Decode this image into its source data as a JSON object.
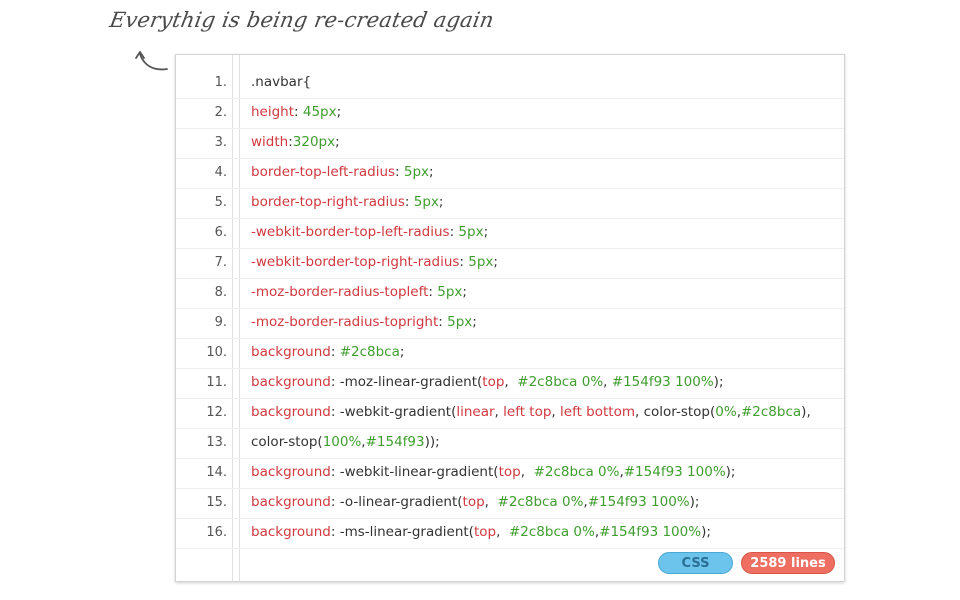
{
  "header": {
    "note": "Everythig is being re-created again"
  },
  "editor": {
    "lines": [
      {
        "number": "1.",
        "tokens": [
          {
            "text": ".navbar{",
            "type": "plain"
          }
        ]
      },
      {
        "number": "2.",
        "tokens": [
          {
            "text": "height",
            "type": "prop"
          },
          {
            "text": ": ",
            "type": "plain"
          },
          {
            "text": "45px",
            "type": "val"
          },
          {
            "text": ";",
            "type": "plain"
          }
        ]
      },
      {
        "number": "3.",
        "tokens": [
          {
            "text": "width",
            "type": "prop"
          },
          {
            "text": ":",
            "type": "plain"
          },
          {
            "text": "320px",
            "type": "val"
          },
          {
            "text": ";",
            "type": "plain"
          }
        ]
      },
      {
        "number": "4.",
        "tokens": [
          {
            "text": "border-top-left-radius",
            "type": "prop"
          },
          {
            "text": ": ",
            "type": "plain"
          },
          {
            "text": "5px",
            "type": "val"
          },
          {
            "text": ";",
            "type": "plain"
          }
        ]
      },
      {
        "number": "5.",
        "tokens": [
          {
            "text": "border-top-right-radius",
            "type": "prop"
          },
          {
            "text": ": ",
            "type": "plain"
          },
          {
            "text": "5px",
            "type": "val"
          },
          {
            "text": ";",
            "type": "plain"
          }
        ]
      },
      {
        "number": "6.",
        "tokens": [
          {
            "text": "-webkit-border-top-left-radius",
            "type": "prop"
          },
          {
            "text": ": ",
            "type": "plain"
          },
          {
            "text": "5px",
            "type": "val"
          },
          {
            "text": ";",
            "type": "plain"
          }
        ]
      },
      {
        "number": "7.",
        "tokens": [
          {
            "text": "-webkit-border-top-right-radius",
            "type": "prop"
          },
          {
            "text": ": ",
            "type": "plain"
          },
          {
            "text": "5px",
            "type": "val"
          },
          {
            "text": ";",
            "type": "plain"
          }
        ]
      },
      {
        "number": "8.",
        "tokens": [
          {
            "text": "-moz-border-radius-topleft",
            "type": "prop"
          },
          {
            "text": ": ",
            "type": "plain"
          },
          {
            "text": "5px",
            "type": "val"
          },
          {
            "text": ";",
            "type": "plain"
          }
        ]
      },
      {
        "number": "9.",
        "tokens": [
          {
            "text": "-moz-border-radius-topright",
            "type": "prop"
          },
          {
            "text": ": ",
            "type": "plain"
          },
          {
            "text": "5px",
            "type": "val"
          },
          {
            "text": ";",
            "type": "plain"
          }
        ]
      },
      {
        "number": "10.",
        "tokens": [
          {
            "text": "background",
            "type": "prop"
          },
          {
            "text": ": ",
            "type": "plain"
          },
          {
            "text": "#2c8bca",
            "type": "val"
          },
          {
            "text": ";",
            "type": "plain"
          }
        ]
      },
      {
        "number": "11.",
        "tokens": [
          {
            "text": "background",
            "type": "prop"
          },
          {
            "text": ": -moz-linear-gradient(",
            "type": "plain"
          },
          {
            "text": "top",
            "type": "prop"
          },
          {
            "text": ",  ",
            "type": "plain"
          },
          {
            "text": "#2c8bca 0%",
            "type": "val"
          },
          {
            "text": ", ",
            "type": "plain"
          },
          {
            "text": "#154f93 100%",
            "type": "val"
          },
          {
            "text": ");",
            "type": "plain"
          }
        ]
      },
      {
        "number": "12.",
        "tokens": [
          {
            "text": "background",
            "type": "prop"
          },
          {
            "text": ": -webkit-gradient(",
            "type": "plain"
          },
          {
            "text": "linear",
            "type": "prop"
          },
          {
            "text": ", ",
            "type": "plain"
          },
          {
            "text": "left top",
            "type": "prop"
          },
          {
            "text": ", ",
            "type": "plain"
          },
          {
            "text": "left bottom",
            "type": "prop"
          },
          {
            "text": ", color-stop(",
            "type": "plain"
          },
          {
            "text": "0%",
            "type": "val"
          },
          {
            "text": ",",
            "type": "plain"
          },
          {
            "text": "#2c8bca",
            "type": "val"
          },
          {
            "text": "),",
            "type": "plain"
          }
        ]
      },
      {
        "number": "13.",
        "tokens": [
          {
            "text": "color-stop(",
            "type": "plain"
          },
          {
            "text": "100%",
            "type": "val"
          },
          {
            "text": ",",
            "type": "plain"
          },
          {
            "text": "#154f93",
            "type": "val"
          },
          {
            "text": "));",
            "type": "plain"
          }
        ]
      },
      {
        "number": "14.",
        "tokens": [
          {
            "text": "background",
            "type": "prop"
          },
          {
            "text": ": -webkit-linear-gradient(",
            "type": "plain"
          },
          {
            "text": "top",
            "type": "prop"
          },
          {
            "text": ",  ",
            "type": "plain"
          },
          {
            "text": "#2c8bca 0%",
            "type": "val"
          },
          {
            "text": ",",
            "type": "plain"
          },
          {
            "text": "#154f93 100%",
            "type": "val"
          },
          {
            "text": ");",
            "type": "plain"
          }
        ]
      },
      {
        "number": "15.",
        "tokens": [
          {
            "text": "background",
            "type": "prop"
          },
          {
            "text": ": -o-linear-gradient(",
            "type": "plain"
          },
          {
            "text": "top",
            "type": "prop"
          },
          {
            "text": ",  ",
            "type": "plain"
          },
          {
            "text": "#2c8bca 0%",
            "type": "val"
          },
          {
            "text": ",",
            "type": "plain"
          },
          {
            "text": "#154f93 100%",
            "type": "val"
          },
          {
            "text": ");",
            "type": "plain"
          }
        ]
      },
      {
        "number": "16.",
        "tokens": [
          {
            "text": "background",
            "type": "prop"
          },
          {
            "text": ": -ms-linear-gradient(",
            "type": "plain"
          },
          {
            "text": "top",
            "type": "prop"
          },
          {
            "text": ",  ",
            "type": "plain"
          },
          {
            "text": "#2c8bca 0%",
            "type": "val"
          },
          {
            "text": ",",
            "type": "plain"
          },
          {
            "text": "#154f93 100%",
            "type": "val"
          },
          {
            "text": ");",
            "type": "plain"
          }
        ]
      }
    ],
    "footer": {
      "language_badge": "CSS",
      "lines_badge": "2589 lines"
    }
  },
  "colors": {
    "property": "#d0393f",
    "value": "#3f9e2f",
    "plain": "#333333",
    "badge_language_bg": "#6cc3ec",
    "badge_lines_bg": "#ee6f61"
  },
  "icons": {
    "note_arrow": "curved-arrow-icon"
  }
}
